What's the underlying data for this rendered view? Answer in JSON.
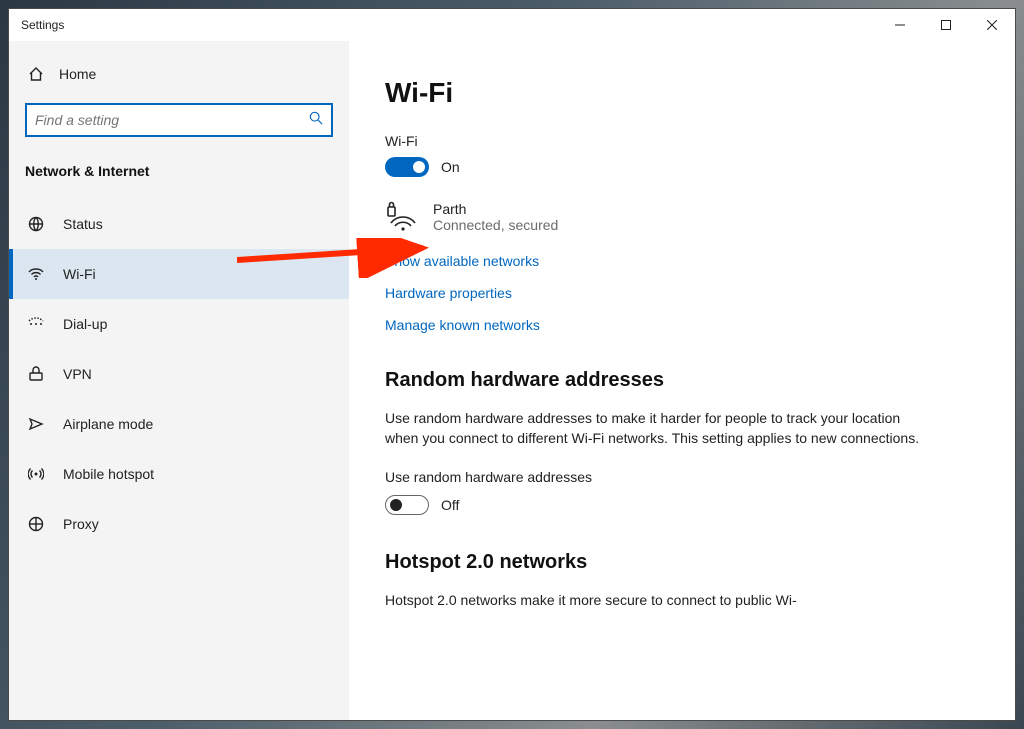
{
  "window": {
    "title": "Settings"
  },
  "sidebar": {
    "home_label": "Home",
    "search_placeholder": "Find a setting",
    "group_header": "Network & Internet",
    "items": [
      {
        "label": "Status"
      },
      {
        "label": "Wi-Fi"
      },
      {
        "label": "Dial-up"
      },
      {
        "label": "VPN"
      },
      {
        "label": "Airplane mode"
      },
      {
        "label": "Mobile hotspot"
      },
      {
        "label": "Proxy"
      }
    ]
  },
  "main": {
    "page_title": "Wi-Fi",
    "wifi_toggle": {
      "label": "Wi-Fi",
      "state_text": "On",
      "on": true
    },
    "current_network": {
      "name": "Parth",
      "status": "Connected, secured"
    },
    "links": {
      "show_networks": "Show available networks",
      "hardware_props": "Hardware properties",
      "manage_known": "Manage known networks"
    },
    "random_hw": {
      "title": "Random hardware addresses",
      "description": "Use random hardware addresses to make it harder for people to track your location when you connect to different Wi-Fi networks. This setting applies to new connections.",
      "toggle_label": "Use random hardware addresses",
      "state_text": "Off",
      "on": false
    },
    "hotspot2": {
      "title": "Hotspot 2.0 networks",
      "description": "Hotspot 2.0 networks make it more secure to connect to public Wi-"
    }
  },
  "annotation": {
    "arrow_color": "#ff0000"
  }
}
